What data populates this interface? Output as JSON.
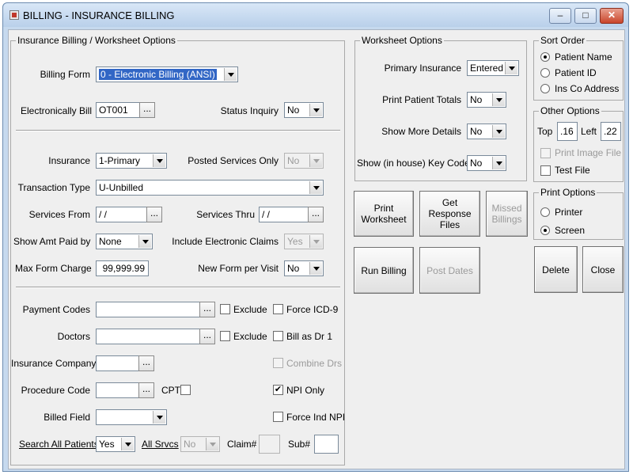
{
  "window": {
    "title": "BILLING - INSURANCE BILLING",
    "minimize": "–",
    "maximize": "□",
    "close": "✕"
  },
  "billing_group": {
    "title": "Insurance Billing / Worksheet Options",
    "billing_form_label": "Billing Form",
    "billing_form_value": "0 - Electronic Billing (ANSI)",
    "electronically_bill_label": "Electronically Bill",
    "electronically_bill_value": "OT001",
    "status_inquiry_label": "Status Inquiry",
    "status_inquiry_value": "No",
    "insurance_label": "Insurance",
    "insurance_value": "1-Primary",
    "posted_services_only_label": "Posted Services Only",
    "posted_services_only_value": "No",
    "transaction_type_label": "Transaction Type",
    "transaction_type_value": "U-Unbilled",
    "services_from_label": "Services From",
    "services_from_value": " / /",
    "services_thru_label": "Services Thru",
    "services_thru_value": " / /",
    "show_amt_paid_by_label": "Show Amt Paid by",
    "show_amt_paid_by_value": "None",
    "include_electronic_claims_label": "Include Electronic Claims",
    "include_electronic_claims_value": "Yes",
    "max_form_charge_label": "Max Form Charge",
    "max_form_charge_value": "99,999.99",
    "new_form_per_visit_label": "New Form per Visit",
    "new_form_per_visit_value": "No",
    "payment_codes_label": "Payment Codes",
    "doctors_label": "Doctors",
    "exclude_label": "Exclude",
    "force_icd9_label": "Force ICD-9",
    "bill_as_dr1_label": "Bill as Dr 1",
    "insurance_company_label": "Insurance Company",
    "combine_drs_label": "Combine Drs",
    "procedure_code_label": "Procedure Code",
    "cpt_label": "CPT",
    "npi_only_label": "NPI Only",
    "billed_field_label": "Billed Field",
    "force_ind_npi_label": "Force Ind NPI",
    "search_all_patients_label": "Search All Patients",
    "search_all_patients_value": "Yes",
    "all_srvcs_label": "All Srvcs",
    "all_srvcs_value": "No",
    "claim_label": "Claim#",
    "sub_label": "Sub#",
    "ellipsis": "..."
  },
  "worksheet_group": {
    "title": "Worksheet Options",
    "primary_insurance_label": "Primary Insurance",
    "primary_insurance_value": "Entered",
    "print_patient_totals_label": "Print Patient Totals",
    "print_patient_totals_value": "No",
    "show_more_details_label": "Show More Details",
    "show_more_details_value": "No",
    "show_key_codes_label": "Show (in house) Key Codes",
    "show_key_codes_value": "No"
  },
  "sort_order": {
    "title": "Sort Order",
    "options": [
      "Patient Name",
      "Patient ID",
      "Ins Co Address"
    ]
  },
  "other_options": {
    "title": "Other Options",
    "top_label": "Top",
    "top_value": ".16",
    "left_label": "Left",
    "left_value": ".22",
    "print_image_file_label": "Print Image File",
    "test_file_label": "Test File"
  },
  "print_options": {
    "title": "Print Options",
    "options": [
      "Printer",
      "Screen"
    ]
  },
  "buttons": {
    "print_worksheet": "Print\nWorksheet",
    "get_response_files": "Get\nResponse\nFiles",
    "missed_billings": "Missed\nBillings",
    "run_billing": "Run Billing",
    "post_dates": "Post Dates",
    "delete": "Delete",
    "close": "Close"
  },
  "checked_mark": "✔"
}
